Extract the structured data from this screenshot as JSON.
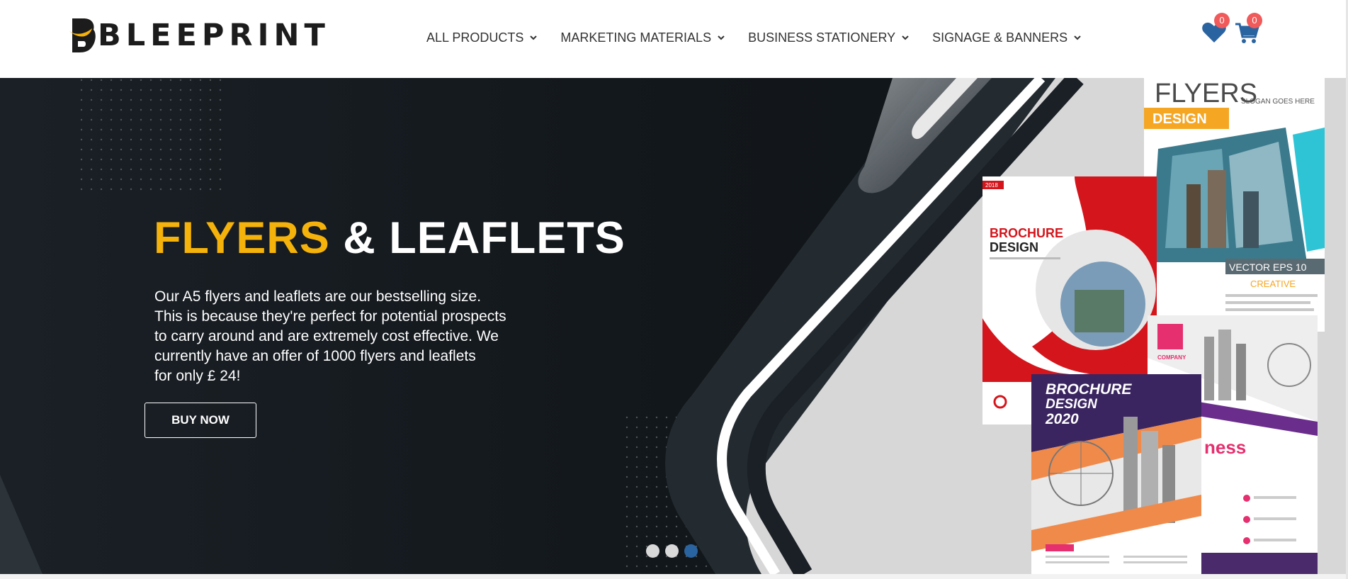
{
  "brand": {
    "name": "BLEEPRINT"
  },
  "nav": {
    "items": [
      {
        "label": "ALL PRODUCTS"
      },
      {
        "label": "MARKETING MATERIALS"
      },
      {
        "label": "BUSINESS STATIONERY"
      },
      {
        "label": "SIGNAGE & BANNERS"
      }
    ]
  },
  "header_icons": {
    "wishlist": {
      "icon": "heart-icon",
      "count": "0"
    },
    "cart": {
      "icon": "cart-icon",
      "count": "0"
    }
  },
  "hero": {
    "title_accent": "FLYERS",
    "title_rest": " & LEAFLETS",
    "description_lines": [
      "Our A5 flyers and leaflets are our bestselling size.",
      "This is because they're perfect for potential prospects",
      "to carry around and are extremely cost effective. We",
      "currently have an offer of 1000 flyers and leaflets",
      "for only £ 24!"
    ],
    "button_label": "BUY NOW",
    "mockups": {
      "flyer_title": "FLYERS",
      "flyer_sub": "DESIGN",
      "flyer_slogan": "SLOGAN GOES HERE",
      "flyer_vector": "VECTOR EPS 10",
      "flyer_creative": "CREATIVE",
      "brochure1_year": "2018",
      "brochure1_line1": "BROCHURE",
      "brochure1_line2": "DESIGN",
      "brochure2_line1": "BROCHURE",
      "brochure2_line2": "DESIGN",
      "brochure2_line3": "2020",
      "company": "COMPANY",
      "business": "ness"
    }
  },
  "slider": {
    "total": 3,
    "active": 3
  },
  "colors": {
    "accent": "#f5b20a",
    "hero_bg": "#14191d",
    "badge": "#f05a5a",
    "icon_blue": "#2a64a0"
  }
}
